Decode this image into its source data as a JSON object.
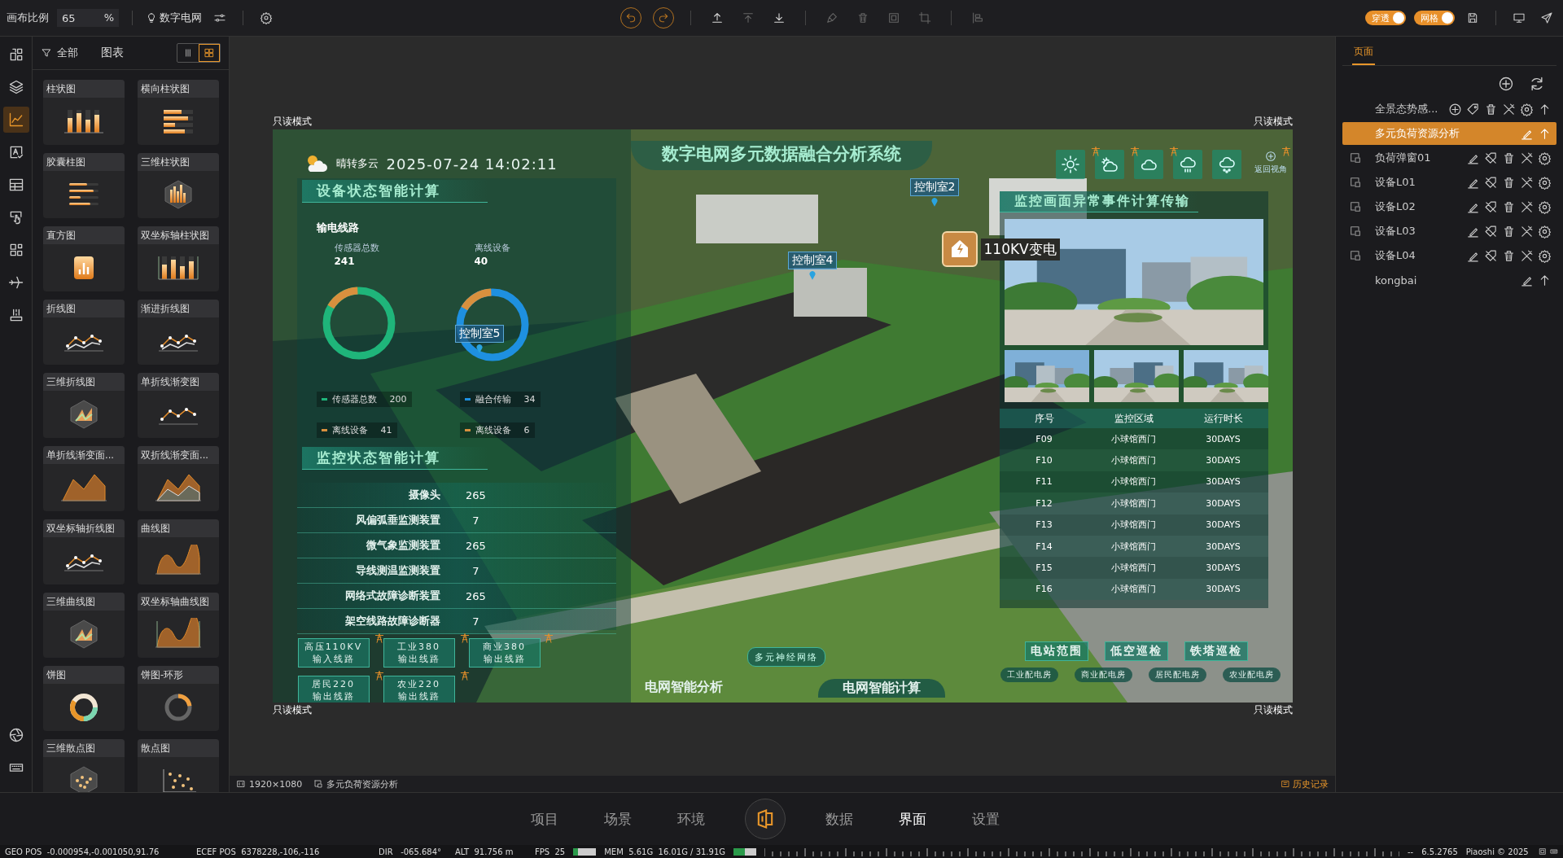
{
  "top_bar": {
    "scale_label": "画布比例",
    "scale_value": "65",
    "scale_unit": "%",
    "project_name": "数字电网",
    "toggles": [
      {
        "label": "穿透",
        "on": true
      },
      {
        "label": "网格",
        "on": true
      }
    ]
  },
  "toolbar": [
    {
      "disabled": false
    },
    {
      "disabled": false
    },
    {
      "disabled": false
    },
    {
      "disabled": true
    },
    {
      "disabled": false
    },
    {
      "disabled": true
    },
    {
      "disabled": true
    },
    {
      "disabled": true
    },
    {
      "disabled": true
    },
    {
      "disabled": true
    }
  ],
  "left_rail": [
    {
      "selected": false
    },
    {
      "selected": false
    },
    {
      "selected": true
    },
    {
      "selected": false
    },
    {
      "selected": false
    },
    {
      "selected": false
    },
    {
      "selected": false
    },
    {
      "selected": false
    },
    {
      "selected": false
    },
    {
      "selected": false
    },
    {
      "selected": false
    }
  ],
  "chart_panel": {
    "filter_label": "全部",
    "title": "图表",
    "view_modes": [
      {
        "selected": false
      },
      {
        "selected": true
      }
    ],
    "cards": [
      {
        "label": "柱状图",
        "kind": "bar"
      },
      {
        "label": "横向柱状图",
        "kind": "hbar"
      },
      {
        "label": "胶囊柱图",
        "kind": "capsule"
      },
      {
        "label": "三维柱状图",
        "kind": "bar3d"
      },
      {
        "label": "直方图",
        "kind": "histogram"
      },
      {
        "label": "双坐标轴柱状图",
        "kind": "dualbar"
      },
      {
        "label": "折线图",
        "kind": "line"
      },
      {
        "label": "渐进折线图",
        "kind": "progline"
      },
      {
        "label": "三维折线图",
        "kind": "line3d"
      },
      {
        "label": "单折线渐变图",
        "kind": "singleline"
      },
      {
        "label": "单折线渐变面...",
        "kind": "area"
      },
      {
        "label": "双折线渐变面...",
        "kind": "dualarea"
      },
      {
        "label": "双坐标轴折线图",
        "kind": "dualline"
      },
      {
        "label": "曲线图",
        "kind": "curve"
      },
      {
        "label": "三维曲线图",
        "kind": "curve3d"
      },
      {
        "label": "双坐标轴曲线图",
        "kind": "dualcurve"
      },
      {
        "label": "饼图",
        "kind": "pie"
      },
      {
        "label": "饼图-环形",
        "kind": "ring"
      },
      {
        "label": "三维散点图",
        "kind": "scatter3d"
      },
      {
        "label": "散点图",
        "kind": "scatter"
      }
    ]
  },
  "canvas_area": {
    "mode_labels": [
      "只读模式",
      "只读模式",
      "只读模式",
      "只读模式"
    ],
    "size": "1920×1080",
    "page": "多元负荷资源分析",
    "history": "历史记录"
  },
  "dashboard": {
    "weather": "晴转多云",
    "datetime": "2025-07-24 14:02:11",
    "title": "数字电网多元数据融合分析系统",
    "view_reset": "返回视角",
    "device_section": {
      "title": "设备状态智能计算",
      "subtitle": "输电线路",
      "stats": [
        {
          "label": "传感器总数",
          "value": "241"
        },
        {
          "label": "离线设备",
          "value": "40"
        }
      ],
      "donuts": [
        {
          "color": "#1fb57a",
          "level": 0.16,
          "legend": [
            {
              "label": "传感器总数",
              "value": "200"
            },
            {
              "label": "离线设备",
              "value": "41"
            }
          ]
        },
        {
          "color": "#1e90e0",
          "level": 0.16,
          "legend": [
            {
              "label": "融合传输",
              "value": "34"
            },
            {
              "label": "离线设备",
              "value": "6"
            }
          ]
        }
      ]
    },
    "monitor_section": {
      "title": "监控状态智能计算",
      "rows": [
        {
          "label": "摄像头",
          "value": "265"
        },
        {
          "label": "风偏弧垂监测装置",
          "value": "7"
        },
        {
          "label": "微气象监测装置",
          "value": "265"
        },
        {
          "label": "导线测温监测装置",
          "value": "7"
        },
        {
          "label": "网络式故障诊断装置",
          "value": "265"
        },
        {
          "label": "架空线路故障诊断器",
          "value": "7"
        }
      ]
    },
    "line_buttons": [
      {
        "top": "高压110KV",
        "bottom": "输入线路"
      },
      {
        "top": "工业380",
        "bottom": "输出线路"
      },
      {
        "top": "商业380",
        "bottom": "输出线路"
      },
      {
        "top": "居民220",
        "bottom": "输出线路"
      },
      {
        "top": "农业220",
        "bottom": "输出线路"
      }
    ],
    "network_button": "多元神经网络",
    "bottom_titles": [
      "电网智能分析",
      "电网智能计算"
    ],
    "map_labels": [
      "控制室2",
      "控制室4",
      "控制室5"
    ],
    "station_label": "110KV变电",
    "event_panel": {
      "title": "监控画面异常事件计算传输",
      "columns": [
        "序号",
        "监控区域",
        "运行时长"
      ],
      "rows": [
        [
          "F09",
          "小球馆西门",
          "30DAYS"
        ],
        [
          "F10",
          "小球馆西门",
          "30DAYS"
        ],
        [
          "F11",
          "小球馆西门",
          "30DAYS"
        ],
        [
          "F12",
          "小球馆西门",
          "30DAYS"
        ],
        [
          "F13",
          "小球馆西门",
          "30DAYS"
        ],
        [
          "F14",
          "小球馆西门",
          "30DAYS"
        ],
        [
          "F15",
          "小球馆西门",
          "30DAYS"
        ],
        [
          "F16",
          "小球馆西门",
          "30DAYS"
        ]
      ]
    },
    "inspect_buttons": [
      "电站范围",
      "低空巡检",
      "铁塔巡检"
    ],
    "room_buttons": [
      "工业配电房",
      "商业配电房",
      "居民配电房",
      "农业配电房"
    ]
  },
  "right_panel": {
    "tabs": [
      {
        "label": "页面",
        "selected": true
      }
    ],
    "pages": [
      {
        "label": "全景态势感...",
        "kind": "group",
        "selected": false
      },
      {
        "label": "多元负荷资源分析",
        "kind": "page",
        "selected": true
      },
      {
        "label": "负荷弹窗01",
        "kind": "popup",
        "selected": false
      },
      {
        "label": "设备L01",
        "kind": "popup",
        "selected": false
      },
      {
        "label": "设备L02",
        "kind": "popup",
        "selected": false
      },
      {
        "label": "设备L03",
        "kind": "popup",
        "selected": false
      },
      {
        "label": "设备L04",
        "kind": "popup",
        "selected": false
      },
      {
        "label": "kongbai",
        "kind": "page",
        "selected": false
      }
    ]
  },
  "bottom_nav": [
    {
      "label": "项目",
      "selected": false
    },
    {
      "label": "场景",
      "selected": false
    },
    {
      "label": "环境",
      "selected": false
    },
    {
      "label": "数据",
      "selected": false
    },
    {
      "label": "界面",
      "selected": true
    },
    {
      "label": "设置",
      "selected": false
    }
  ],
  "status_bar": {
    "geo_label": "GEO POS",
    "geo": "-0.000954,-0.001050,91.76",
    "ecef_label": "ECEF POS",
    "ecef": "6378228,-106,-116",
    "dir_label": "DIR",
    "dir": "-065.684°",
    "alt_label": "ALT",
    "alt": "91.756 m",
    "fps_label": "FPS",
    "fps": "25",
    "fps_meter": {
      "level": 0.2
    },
    "mem_label": "MEM",
    "mem": "5.61G",
    "mem_total": "16.01G / 31.91G",
    "mem_meter": {
      "level": 0.5
    },
    "dashes": "--",
    "version": "6.5.2765",
    "copyright": "Piaoshi © 2025"
  }
}
